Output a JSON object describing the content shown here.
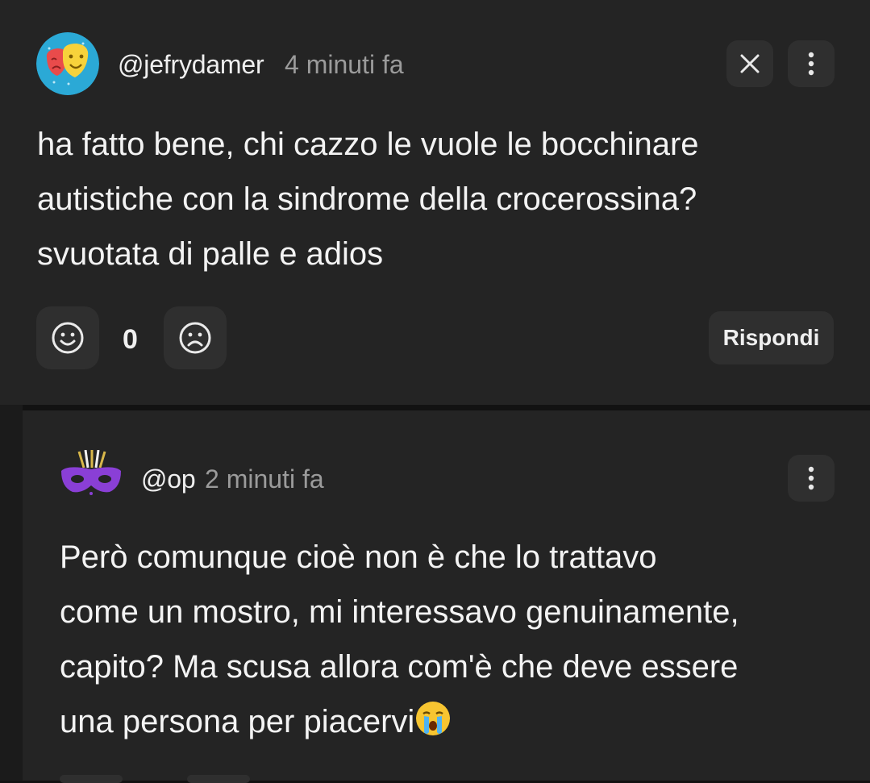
{
  "comments": [
    {
      "username": "@jefrydamer",
      "timestamp": "4 minuti fa",
      "avatar_icon": "theater-masks-icon",
      "body": "ha fatto bene, chi cazzo le vuole le bocchinare\nautistiche con la sindrome della crocerossina?\nsvuotata di palle e adios",
      "vote_count": "0",
      "reply_label": "Rispondi"
    },
    {
      "username": "@op",
      "timestamp": "2 minuti fa",
      "avatar_icon": "carnival-mask-icon",
      "body": "Però comunque cioè non è che lo trattavo\ncome un mostro, mi interessavo genuinamente,\ncapito? Ma scusa allora com'è che deve essere\nuna persona per piacervi",
      "body_emoji": "crying-face-icon"
    }
  ],
  "colors": {
    "background": "#121212",
    "card": "#242424",
    "button": "#2f2f2f",
    "text": "#f1f1f1",
    "muted": "#9b9b9b",
    "avatar_bg": "#2ba9d6",
    "mask_purple": "#8a3fd6"
  }
}
